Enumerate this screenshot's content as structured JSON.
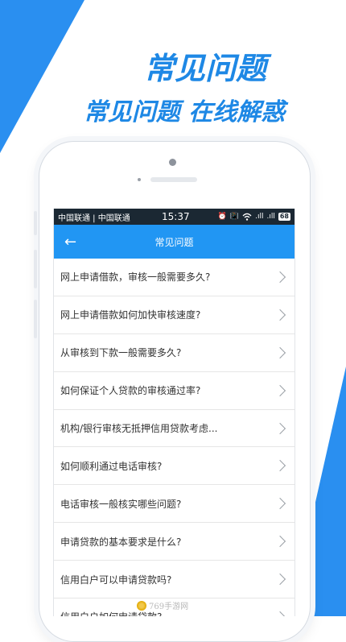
{
  "promo": {
    "title": "常见问题",
    "subtitle": "常见问题  在线解惑"
  },
  "status_bar": {
    "carrier": "中国联通 | 中国联通",
    "time": "15:37",
    "alarm_icon": "⏰",
    "vibrate_icon": "📳",
    "wifi_icon": "wifi-icon",
    "signal_1": ".ıll",
    "signal_2": ".ıll",
    "battery": "68"
  },
  "navbar": {
    "back_icon": "←",
    "title": "常见问题"
  },
  "faq_items": [
    {
      "text": "网上申请借款，审核一般需要多久?"
    },
    {
      "text": "网上申请借款如何加快审核速度?"
    },
    {
      "text": "从审核到下款一般需要多久?"
    },
    {
      "text": "如何保证个人贷款的审核通过率?"
    },
    {
      "text": "机构/银行审核无抵押信用贷款考虑..."
    },
    {
      "text": "如何顺利通过电话审核?"
    },
    {
      "text": "电话审核一般核实哪些问题?"
    },
    {
      "text": "申请贷款的基本要求是什么?"
    },
    {
      "text": "信用白户可以申请贷款吗?"
    },
    {
      "text": "信用白户如何申请贷款?"
    }
  ],
  "watermark": "769手游网",
  "colors": {
    "accent": "#2196f3",
    "background_shape": "#2a8ff0",
    "status_bar": "#1b2833",
    "headline": "#1e88e5"
  }
}
